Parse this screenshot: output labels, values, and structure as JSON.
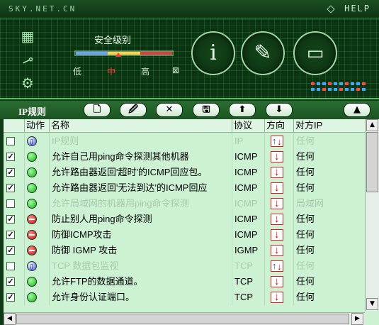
{
  "app": {
    "brand": "SKY.NET.CN",
    "help_label": "HELP"
  },
  "security_level": {
    "title": "安全级别",
    "levels": [
      "低",
      "中",
      "高",
      "⊠"
    ],
    "selected": "中"
  },
  "icons": {
    "side_buttons": [
      "calculator-icon",
      "link-icon",
      "gear-icon"
    ],
    "circle_buttons": [
      {
        "name": "info-icon",
        "glyph": "i"
      },
      {
        "name": "pencil-icon",
        "glyph": "✎"
      },
      {
        "name": "computer-icon",
        "glyph": "🖳"
      }
    ]
  },
  "toolbar": {
    "title": "IP规则",
    "buttons": [
      {
        "name": "new-rule-button",
        "glyph": "🗋"
      },
      {
        "name": "edit-rule-button",
        "glyph": "🖉"
      },
      {
        "name": "delete-rule-button",
        "glyph": "✕"
      },
      {
        "name": "save-rule-button",
        "glyph": "🖫"
      },
      {
        "name": "move-up-button",
        "glyph": "⬆"
      },
      {
        "name": "move-down-button",
        "glyph": "⬇"
      },
      {
        "name": "collapse-button",
        "glyph": "▲"
      }
    ]
  },
  "table": {
    "headers": [
      "",
      "动作",
      "名称",
      "协议",
      "方向",
      "对方IP"
    ],
    "rows": [
      {
        "checked": false,
        "action": "monitor",
        "name": "IP规则",
        "protocol": "IP",
        "direction": "both",
        "remote": "任何",
        "enabled": false
      },
      {
        "checked": true,
        "action": "allow",
        "name": "允许自己用ping命令探测其他机器",
        "protocol": "ICMP",
        "direction": "out",
        "remote": "任何",
        "enabled": true
      },
      {
        "checked": true,
        "action": "allow",
        "name": "允许路由器返回'超时'的ICMP回应包。",
        "protocol": "ICMP",
        "direction": "out",
        "remote": "任何",
        "enabled": true
      },
      {
        "checked": true,
        "action": "allow",
        "name": "允许路由器返回'无法到达'的ICMP回应",
        "protocol": "ICMP",
        "direction": "out",
        "remote": "任何",
        "enabled": true
      },
      {
        "checked": false,
        "action": "allow",
        "name": "允许局域网的机器用ping命令探测",
        "protocol": "ICMP",
        "direction": "out",
        "remote": "局域网",
        "enabled": false
      },
      {
        "checked": true,
        "action": "deny",
        "name": "防止别人用ping命令探测",
        "protocol": "ICMP",
        "direction": "out",
        "remote": "任何",
        "enabled": true
      },
      {
        "checked": true,
        "action": "deny",
        "name": "防御ICMP攻击",
        "protocol": "ICMP",
        "direction": "out",
        "remote": "任何",
        "enabled": true
      },
      {
        "checked": true,
        "action": "deny",
        "name": "防御 IGMP 攻击",
        "protocol": "IGMP",
        "direction": "out",
        "remote": "任何",
        "enabled": true
      },
      {
        "checked": false,
        "action": "monitor",
        "name": "TCP 数据包监视",
        "protocol": "TCP",
        "direction": "both",
        "remote": "任何",
        "enabled": false
      },
      {
        "checked": true,
        "action": "allow",
        "name": "允许FTP的数据通道。",
        "protocol": "TCP",
        "direction": "out",
        "remote": "任何",
        "enabled": true
      },
      {
        "checked": true,
        "action": "allow",
        "name": "允许身份认证端口。",
        "protocol": "TCP",
        "direction": "out",
        "remote": "任何",
        "enabled": true
      }
    ]
  },
  "colors": {
    "header_bg": "#0b3512",
    "list_bg": "#ccf1d3",
    "allow": "#17b417",
    "deny": "#c60f0f",
    "monitor": "#3a55d8"
  }
}
